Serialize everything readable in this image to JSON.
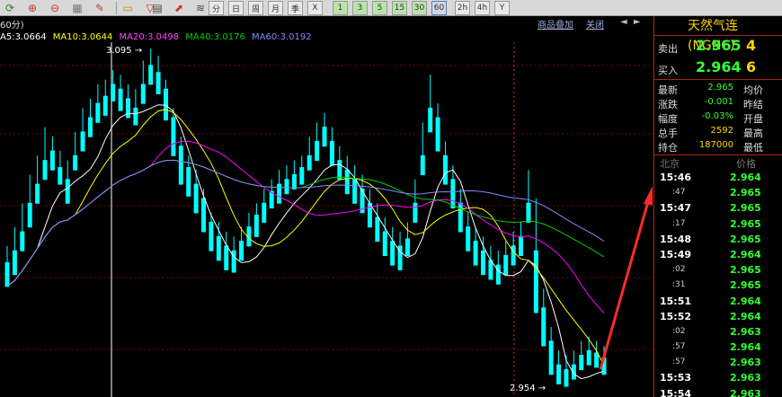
{
  "toolbar": {
    "icons": [
      "refresh-icon",
      "zoom-in-icon",
      "zoom-out-icon",
      "grid-icon",
      "pencil-icon",
      "folder-icon",
      "funnel-icon"
    ],
    "periods": [
      "分",
      "日",
      "周",
      "月",
      "季",
      "X",
      "1",
      "3",
      "5",
      "15",
      "30",
      "60",
      "2h",
      "4h",
      "Y"
    ],
    "active_period": "60"
  },
  "chart_header": {
    "period_label": "60分)",
    "link_products": "商品叠加",
    "link_close": "关闭",
    "scroll_arrows": "◄ ►"
  },
  "ma_legend": {
    "ma5": "A5:3.0664",
    "ma10": "MA10:3.0644",
    "ma20": "MA20:3.0498",
    "ma40": "MA40:3.0176",
    "ma60": "MA60:3.0192"
  },
  "chart_annotations": {
    "high_label": "3.095",
    "low_label": "2.954"
  },
  "colors": {
    "up": "#ff3333",
    "down": "#00ffff",
    "ma5": "#ffffff",
    "ma10": "#ffff00",
    "ma20": "#ff00ff",
    "ma40": "#00cc00",
    "ma60": "#8888ff",
    "grid": "#800000"
  },
  "chart_data": {
    "type": "candlestick",
    "ylim": [
      2.95,
      3.1
    ],
    "candles": [
      [
        3.005,
        3.012,
        2.998,
        2.995
      ],
      [
        3.01,
        3.02,
        3.003,
        3.0
      ],
      [
        3.018,
        3.03,
        3.014,
        3.01
      ],
      [
        3.03,
        3.042,
        3.025,
        3.02
      ],
      [
        3.038,
        3.05,
        3.033,
        3.03
      ],
      [
        3.048,
        3.062,
        3.043,
        3.04
      ],
      [
        3.052,
        3.058,
        3.046,
        3.044
      ],
      [
        3.045,
        3.052,
        3.04,
        3.038
      ],
      [
        3.04,
        3.048,
        3.033,
        3.03
      ],
      [
        3.05,
        3.06,
        3.047,
        3.044
      ],
      [
        3.06,
        3.07,
        3.057,
        3.052
      ],
      [
        3.066,
        3.074,
        3.062,
        3.058
      ],
      [
        3.072,
        3.08,
        3.068,
        3.064
      ],
      [
        3.075,
        3.082,
        3.07,
        3.067
      ],
      [
        3.08,
        3.086,
        3.076,
        3.073
      ],
      [
        3.078,
        3.084,
        3.07,
        3.069
      ],
      [
        3.074,
        3.08,
        3.068,
        3.066
      ],
      [
        3.07,
        3.078,
        3.066,
        3.063
      ],
      [
        3.08,
        3.09,
        3.077,
        3.072
      ],
      [
        3.088,
        3.095,
        3.083,
        3.08
      ],
      [
        3.085,
        3.092,
        3.078,
        3.076
      ],
      [
        3.078,
        3.082,
        3.068,
        3.065
      ],
      [
        3.066,
        3.07,
        3.052,
        3.05
      ],
      [
        3.054,
        3.058,
        3.04,
        3.038
      ],
      [
        3.045,
        3.05,
        3.035,
        3.033
      ],
      [
        3.038,
        3.044,
        3.028,
        3.026
      ],
      [
        3.032,
        3.036,
        3.02,
        3.018
      ],
      [
        3.022,
        3.026,
        3.012,
        3.01
      ],
      [
        3.016,
        3.022,
        3.008,
        3.006
      ],
      [
        3.012,
        3.018,
        3.004,
        3.002
      ],
      [
        3.01,
        3.016,
        3.003,
        3.001
      ],
      [
        3.014,
        3.02,
        3.01,
        3.006
      ],
      [
        3.02,
        3.026,
        3.015,
        3.012
      ],
      [
        3.025,
        3.03,
        3.018,
        3.016
      ],
      [
        3.03,
        3.036,
        3.025,
        3.022
      ],
      [
        3.035,
        3.04,
        3.03,
        3.028
      ],
      [
        3.038,
        3.044,
        3.032,
        3.03
      ],
      [
        3.04,
        3.046,
        3.036,
        3.034
      ],
      [
        3.042,
        3.048,
        3.038,
        3.036
      ],
      [
        3.045,
        3.05,
        3.04,
        3.038
      ],
      [
        3.05,
        3.058,
        3.046,
        3.044
      ],
      [
        3.056,
        3.064,
        3.05,
        3.048
      ],
      [
        3.062,
        3.068,
        3.056,
        3.054
      ],
      [
        3.056,
        3.062,
        3.048,
        3.046
      ],
      [
        3.048,
        3.054,
        3.042,
        3.04
      ],
      [
        3.044,
        3.05,
        3.036,
        3.034
      ],
      [
        3.04,
        3.046,
        3.032,
        3.03
      ],
      [
        3.036,
        3.042,
        3.028,
        3.026
      ],
      [
        3.03,
        3.036,
        3.022,
        3.02
      ],
      [
        3.024,
        3.03,
        3.016,
        3.014
      ],
      [
        3.018,
        3.024,
        3.01,
        3.008
      ],
      [
        3.014,
        3.02,
        3.006,
        3.004
      ],
      [
        3.012,
        3.018,
        3.005,
        3.002
      ],
      [
        3.015,
        3.022,
        3.01,
        3.008
      ],
      [
        3.03,
        3.04,
        3.026,
        3.022
      ],
      [
        3.05,
        3.064,
        3.046,
        3.042
      ],
      [
        3.07,
        3.084,
        3.064,
        3.06
      ],
      [
        3.066,
        3.072,
        3.054,
        3.052
      ],
      [
        3.05,
        3.056,
        3.04,
        3.038
      ],
      [
        3.04,
        3.046,
        3.03,
        3.028
      ],
      [
        3.03,
        3.036,
        3.02,
        3.018
      ],
      [
        3.02,
        3.026,
        3.012,
        3.01
      ],
      [
        3.014,
        3.02,
        3.006,
        3.004
      ],
      [
        3.01,
        3.016,
        3.002,
        3.0
      ],
      [
        3.006,
        3.012,
        3.0,
        2.998
      ],
      [
        3.004,
        3.01,
        2.998,
        2.996
      ],
      [
        3.008,
        3.014,
        3.002,
        3.0
      ],
      [
        3.012,
        3.018,
        3.006,
        3.004
      ],
      [
        3.016,
        3.022,
        3.01,
        3.008
      ],
      [
        3.03,
        3.044,
        3.026,
        3.022
      ],
      [
        3.01,
        3.032,
        2.986,
        2.984
      ],
      [
        2.986,
        2.994,
        2.972,
        2.97
      ],
      [
        2.972,
        2.978,
        2.96,
        2.958
      ],
      [
        2.962,
        2.968,
        2.956,
        2.954
      ],
      [
        2.96,
        2.966,
        2.955,
        2.953
      ],
      [
        2.962,
        2.968,
        2.958,
        2.956
      ],
      [
        2.966,
        2.972,
        2.962,
        2.96
      ],
      [
        2.968,
        2.974,
        2.964,
        2.962
      ],
      [
        2.967,
        2.972,
        2.963,
        2.961
      ],
      [
        2.965,
        2.97,
        2.96,
        2.958
      ]
    ]
  },
  "panel": {
    "symbol_title": "天然气连(NGNC)",
    "ask_label": "卖出",
    "ask_price": "2.965",
    "ask_vol": "4",
    "bid_label": "买入",
    "bid_price": "2.964",
    "bid_vol": "6",
    "stats": [
      {
        "label": "最新",
        "value": "2.965",
        "label2": "均价",
        "color": "green"
      },
      {
        "label": "涨跌",
        "value": "-0.001",
        "label2": "昨结",
        "color": "green"
      },
      {
        "label": "幅度",
        "value": "-0.03%",
        "label2": "开盘",
        "color": "green"
      },
      {
        "label": "总手",
        "value": "2592",
        "label2": "最高",
        "color": "yellow"
      },
      {
        "label": "持仓",
        "value": "187000",
        "label2": "最低",
        "color": "yellow"
      }
    ],
    "ticks_header_time": "北京",
    "ticks_header_price": "价格",
    "ticks": [
      {
        "time": "15:46",
        "price": "2.964",
        "sub": false
      },
      {
        "time": ":47",
        "price": "2.965",
        "sub": true
      },
      {
        "time": "15:47",
        "price": "2.965",
        "sub": false
      },
      {
        "time": ":17",
        "price": "2.965",
        "sub": true
      },
      {
        "time": "15:48",
        "price": "2.965",
        "sub": false
      },
      {
        "time": "15:49",
        "price": "2.964",
        "sub": false
      },
      {
        "time": ":02",
        "price": "2.965",
        "sub": true
      },
      {
        "time": ":31",
        "price": "2.965",
        "sub": true
      },
      {
        "time": "15:51",
        "price": "2.964",
        "sub": false
      },
      {
        "time": "15:52",
        "price": "2.964",
        "sub": false
      },
      {
        "time": ":02",
        "price": "2.963",
        "sub": true
      },
      {
        "time": ":57",
        "price": "2.964",
        "sub": true
      },
      {
        "time": ":57",
        "price": "2.963",
        "sub": true
      },
      {
        "time": "15:53",
        "price": "2.963",
        "sub": false
      },
      {
        "time": "15:54",
        "price": "2.963",
        "sub": false
      }
    ]
  }
}
